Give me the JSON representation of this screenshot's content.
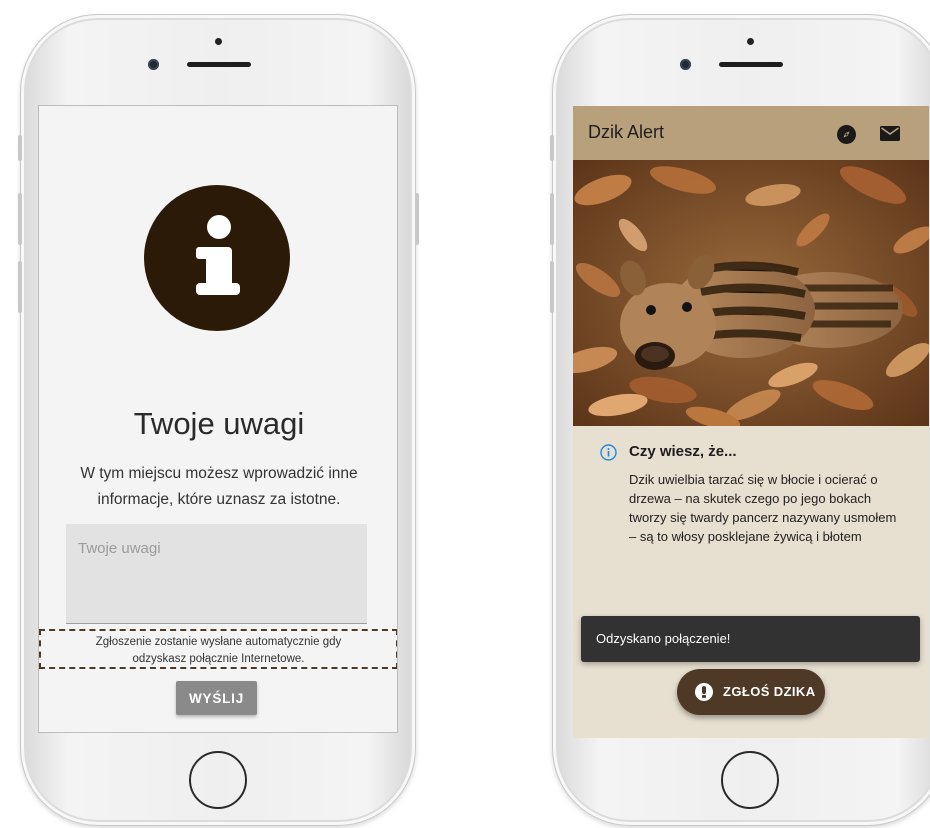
{
  "left_screen": {
    "title": "Twoje uwagi",
    "description": "W tym miejscu możesz wprowadzić inne informacje, które uznasz za istotne.",
    "textarea_placeholder": "Twoje uwagi",
    "textarea_value": "",
    "offline_note": "Zgłoszenie zostanie wysłane automatycznie gdy odzyskasz połącznie Internetowe.",
    "send_label": "WYŚLIJ",
    "icon": "info-icon"
  },
  "right_screen": {
    "app_title": "Dzik Alert",
    "toolbar_icons": [
      "compass-icon",
      "mail-icon"
    ],
    "hero_image": "wild-boar-piglets-in-autumn-leaves",
    "fact_title": "Czy wiesz, że...",
    "fact_text": "Dzik uwielbia tarzać się w błocie i ocierać o drzewa – na skutek czego po jego bokach tworzy się twardy pancerz nazywany usmołem – są to włosy posklejane żywicą i błotem",
    "snackbar_text": "Odzyskano połączenie!",
    "fab_label": "ZGŁOŚ DZIKA",
    "fab_icon": "alert-icon"
  },
  "colors": {
    "app_bar": "#b9a07c",
    "background": "#e7dfcf",
    "info_circle": "#2b1a08",
    "fab": "#4e3826",
    "send_button": "#8a8a8a",
    "fact_icon": "#1e88e5"
  }
}
